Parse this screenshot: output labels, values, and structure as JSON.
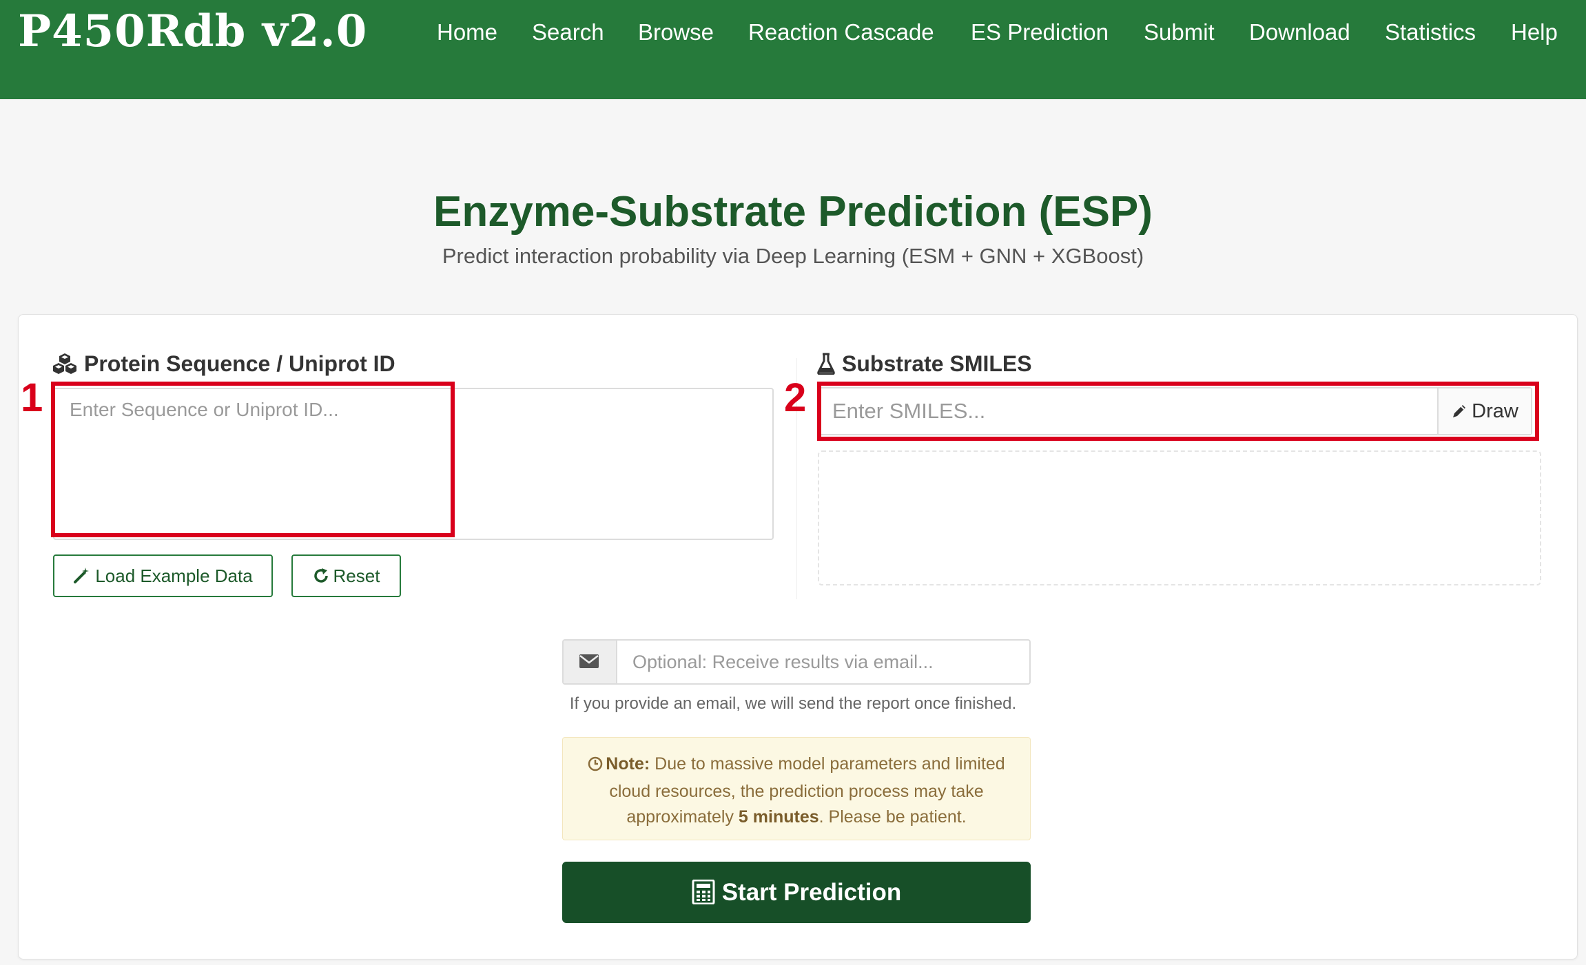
{
  "nav": {
    "brand": "P450Rdb v2.0",
    "items": [
      "Home",
      "Search",
      "Browse",
      "Reaction Cascade",
      "ES Prediction",
      "Submit",
      "Download",
      "Statistics",
      "Help"
    ]
  },
  "header": {
    "title": "Enzyme-Substrate Prediction (ESP)",
    "subtitle": "Predict interaction probability via Deep Learning (ESM + GNN + XGBoost)"
  },
  "protein": {
    "label": "Protein Sequence / Uniprot ID",
    "icon": "cubes-icon",
    "placeholder": "Enter Sequence or Uniprot ID...",
    "value": ""
  },
  "substrate": {
    "label": "Substrate SMILES",
    "icon": "flask-icon",
    "placeholder": "Enter SMILES...",
    "value": "",
    "draw_label": "Draw",
    "draw_icon": "pencil-icon"
  },
  "actions": {
    "load_example": "Load Example Data",
    "load_example_icon": "magic-wand-icon",
    "reset": "Reset",
    "reset_icon": "refresh-icon"
  },
  "email": {
    "icon": "envelope-icon",
    "placeholder": "Optional: Receive results via email...",
    "value": "",
    "help": "If you provide an email, we will send the report once finished."
  },
  "note": {
    "icon": "clock-icon",
    "label": "Note:",
    "text_before": "Due to massive model parameters and limited cloud resources, the prediction process may take approximately",
    "duration": "5 minutes",
    "text_after": ". Please be patient."
  },
  "submit": {
    "label": "Start Prediction",
    "icon": "calculator-icon"
  },
  "annotations": {
    "box1": "1",
    "box2": "2",
    "color": "#d9001b"
  },
  "colors": {
    "navbar": "#267a3b",
    "title": "#1d5a2a",
    "primary_button": "#174f28",
    "note_bg": "#fcf8e3"
  }
}
